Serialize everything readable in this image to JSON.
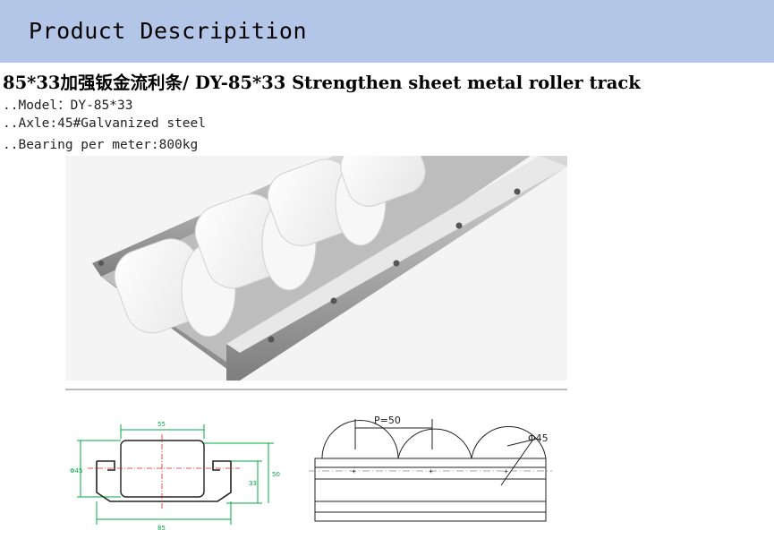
{
  "banner": {
    "title": "Product Descripition"
  },
  "product": {
    "heading": "85*33加强钣金流利条/ DY-85*33 Strengthen sheet metal roller track",
    "specs": [
      "..Model：DY-85*33",
      "..Axle:45#Galvanized steel",
      "..Bearing per meter:800kg"
    ]
  },
  "drawing_front": {
    "dim_top": "55",
    "dim_left": "Φ45",
    "dim_inner": "33",
    "dim_right": "50",
    "dim_bottom": "85"
  },
  "drawing_side": {
    "pitch": "P=50",
    "diameter": "Φ45"
  },
  "colors": {
    "banner": "#b4c6e7",
    "dimension_line": "#00aa44",
    "centerline": "#e02020"
  }
}
